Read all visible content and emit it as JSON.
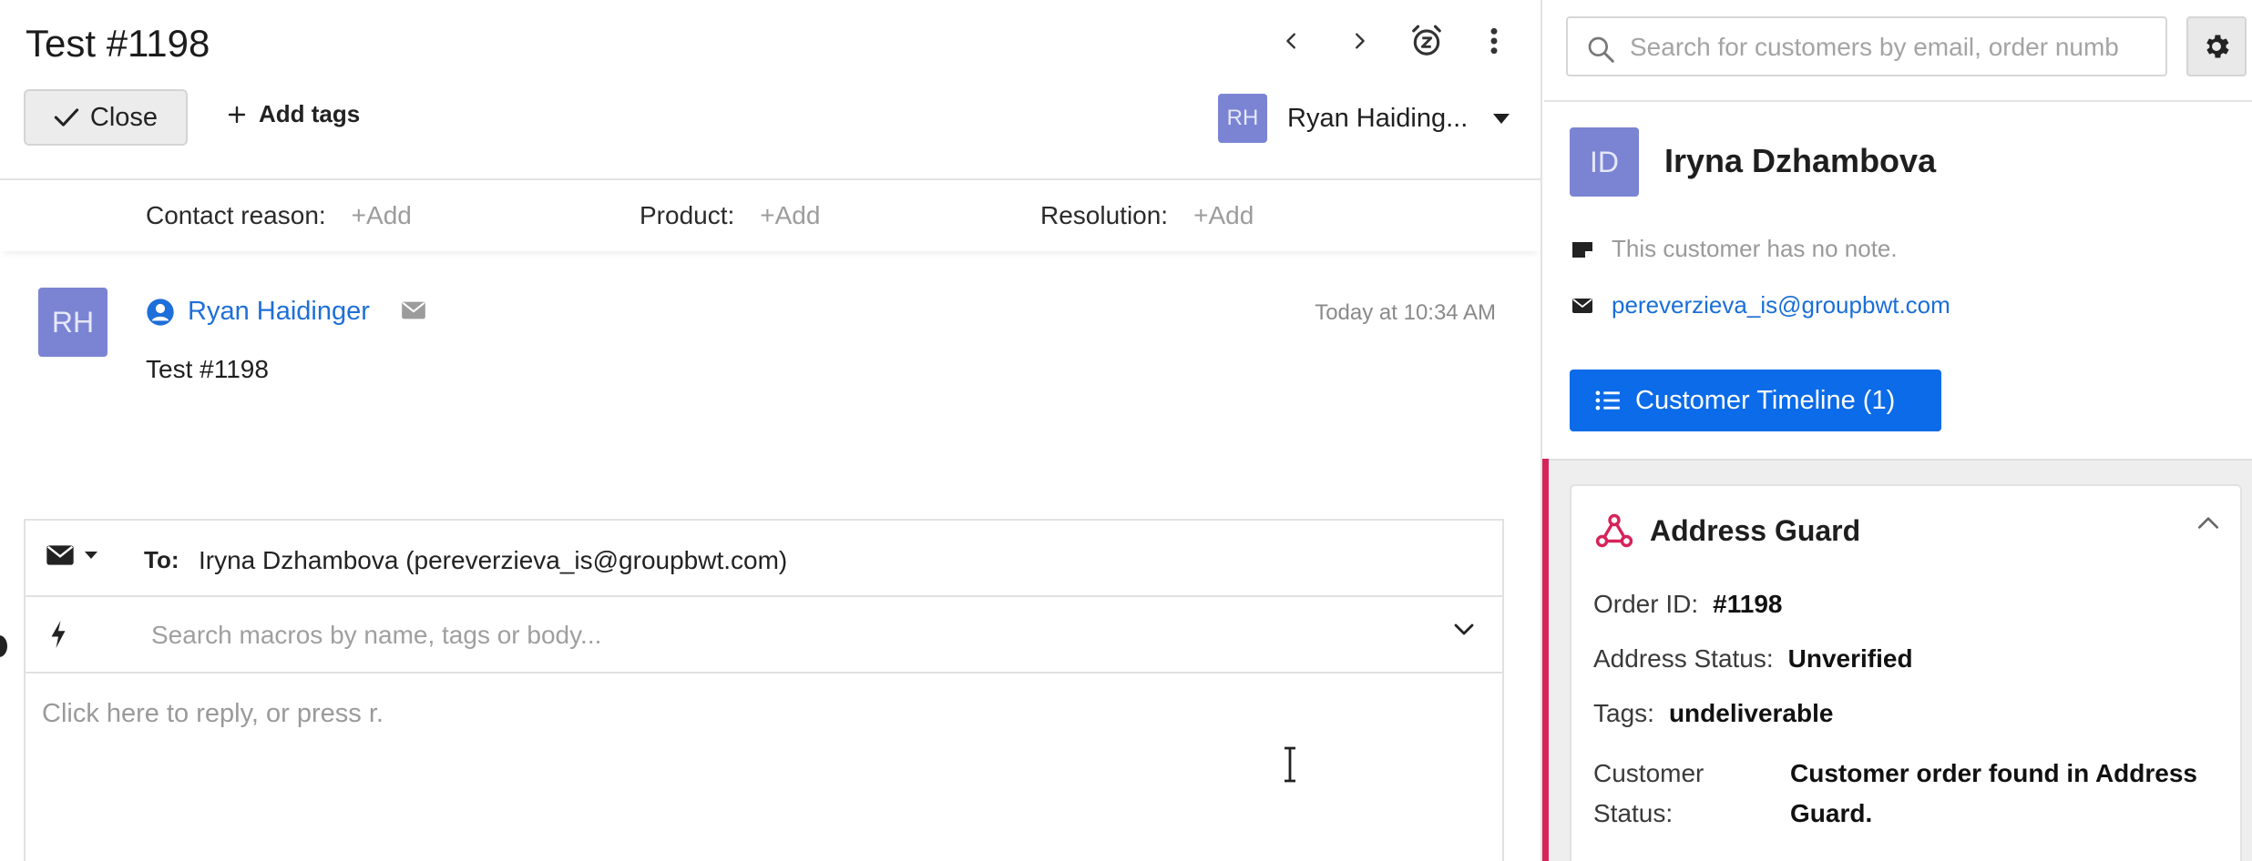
{
  "ticket": {
    "title": "Test #1198",
    "close_label": "Close",
    "add_tags_label": "Add tags",
    "assignee": {
      "initials": "RH",
      "name": "Ryan Haiding..."
    },
    "fields": [
      {
        "label": "Contact reason:",
        "value": "+Add"
      },
      {
        "label": "Product:",
        "value": "+Add"
      },
      {
        "label": "Resolution:",
        "value": "+Add"
      }
    ]
  },
  "message": {
    "initials": "RH",
    "sender": "Ryan Haidinger",
    "time": "Today at 10:34 AM",
    "body": "Test #1198"
  },
  "reply": {
    "to_label": "To:",
    "to_value": "Iryna Dzhambova (pereverzieva_is@groupbwt.com)",
    "macro_placeholder": "Search macros by name, tags or body...",
    "editor_placeholder": "Click here to reply, or press r."
  },
  "sidebar": {
    "search_placeholder": "Search for customers by email, order numb",
    "customer": {
      "initials": "ID",
      "name": "Iryna Dzhambova",
      "note": "This customer has no note.",
      "email": "pereverzieva_is@groupbwt.com",
      "timeline_label": "Customer Timeline (1)"
    },
    "address_guard": {
      "title": "Address Guard",
      "order_id_label": "Order ID:",
      "order_id": "#1198",
      "address_status_label": "Address Status:",
      "address_status": "Unverified",
      "tags_label": "Tags:",
      "tags": "undeliverable",
      "customer_status_label": "Customer Status:",
      "customer_status": "Customer order found in Address Guard."
    }
  },
  "colors": {
    "accent_blue": "#0b6be8",
    "link_blue": "#1e6fd9",
    "avatar": "#7b84d3",
    "app_accent": "#d6245a"
  }
}
